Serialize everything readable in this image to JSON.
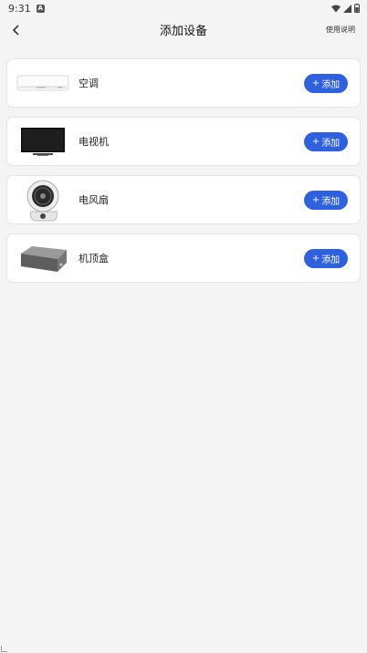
{
  "status_bar": {
    "time": "9:31",
    "notification_icon": "a-notification-icon",
    "icons": [
      "wifi-icon",
      "signal-icon",
      "battery-icon"
    ]
  },
  "header": {
    "title": "添加设备",
    "help_label": "使用说明",
    "back_icon": "chevron-left-icon"
  },
  "devices": [
    {
      "name": "空调",
      "button_label": "添加",
      "image": "air-conditioner"
    },
    {
      "name": "电视机",
      "button_label": "添加",
      "image": "television"
    },
    {
      "name": "电风扇",
      "button_label": "添加",
      "image": "electric-fan"
    },
    {
      "name": "机顶盒",
      "button_label": "添加",
      "image": "set-top-box"
    }
  ],
  "colors": {
    "accent": "#2f60dd",
    "background": "#f4f4f5",
    "card": "#ffffff"
  }
}
